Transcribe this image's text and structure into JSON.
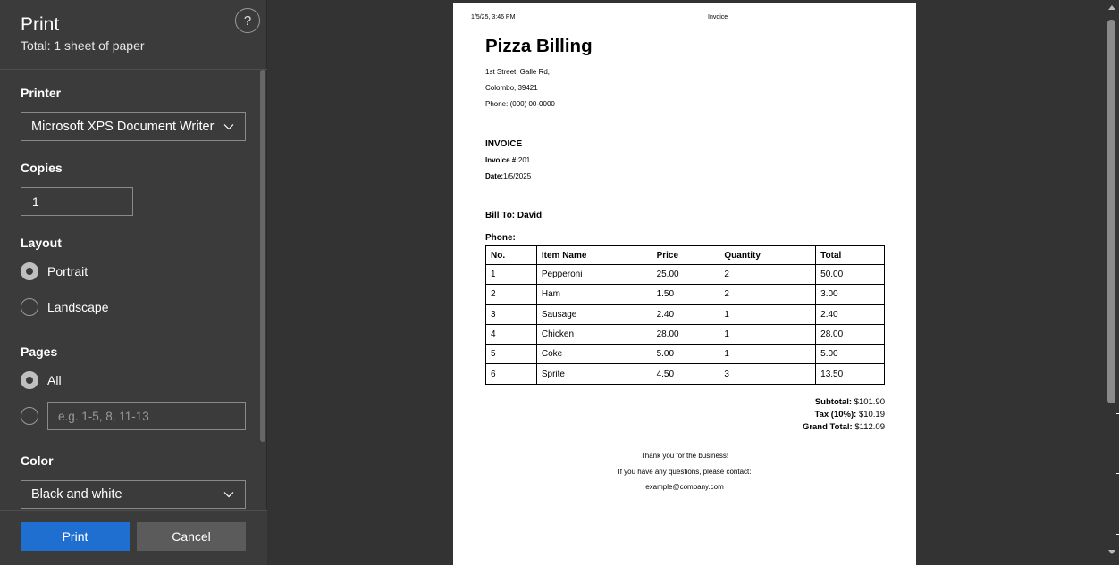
{
  "dialog": {
    "title": "Print",
    "subtitle": "Total: 1 sheet of paper",
    "help_label": "?"
  },
  "printer": {
    "label": "Printer",
    "selected": "Microsoft XPS Document Writer"
  },
  "copies": {
    "label": "Copies",
    "value": "1"
  },
  "layout": {
    "label": "Layout",
    "options": [
      "Portrait",
      "Landscape"
    ],
    "selected": "Portrait"
  },
  "pages": {
    "label": "Pages",
    "all_label": "All",
    "custom_placeholder": "e.g. 1-5, 8, 11-13",
    "selected": "All"
  },
  "color": {
    "label": "Color",
    "selected": "Black and white"
  },
  "actions": {
    "print_label": "Print",
    "cancel_label": "Cancel"
  },
  "preview": {
    "header_date": "1/5/25, 3:46 PM",
    "header_title": "Invoice",
    "doc_title": "Pizza Billing",
    "address": [
      "1st Street, Galle Rd,",
      "Colombo, 39421",
      "Phone: (000) 00-0000"
    ],
    "invoice_heading": "INVOICE",
    "invoice_no_label": "Invoice #:",
    "invoice_no": "201",
    "date_label": "Date:",
    "date": "1/5/2025",
    "bill_to": "Bill To: David",
    "phone_label": "Phone:",
    "table": {
      "headers": [
        "No.",
        "Item Name",
        "Price",
        "Quantity",
        "Total"
      ],
      "rows": [
        [
          "1",
          "Pepperoni",
          "25.00",
          "2",
          "50.00"
        ],
        [
          "2",
          "Ham",
          "1.50",
          "2",
          "3.00"
        ],
        [
          "3",
          "Sausage",
          "2.40",
          "1",
          "2.40"
        ],
        [
          "4",
          "Chicken",
          "28.00",
          "1",
          "28.00"
        ],
        [
          "5",
          "Coke",
          "5.00",
          "1",
          "5.00"
        ],
        [
          "6",
          "Sprite",
          "4.50",
          "3",
          "13.50"
        ]
      ]
    },
    "subtotal_label": "Subtotal:",
    "subtotal": "$101.90",
    "tax_label": "Tax (10%):",
    "tax": "$10.19",
    "grand_total_label": "Grand Total:",
    "grand_total": "$112.09",
    "thanks": "Thank you for the business!",
    "contact_line": "If you have any questions, please contact:",
    "contact_email": "example@company.com"
  },
  "colors": {
    "panel_bg": "#3b3b3b",
    "preview_bg": "#333333",
    "accent": "#1f6fd0"
  }
}
